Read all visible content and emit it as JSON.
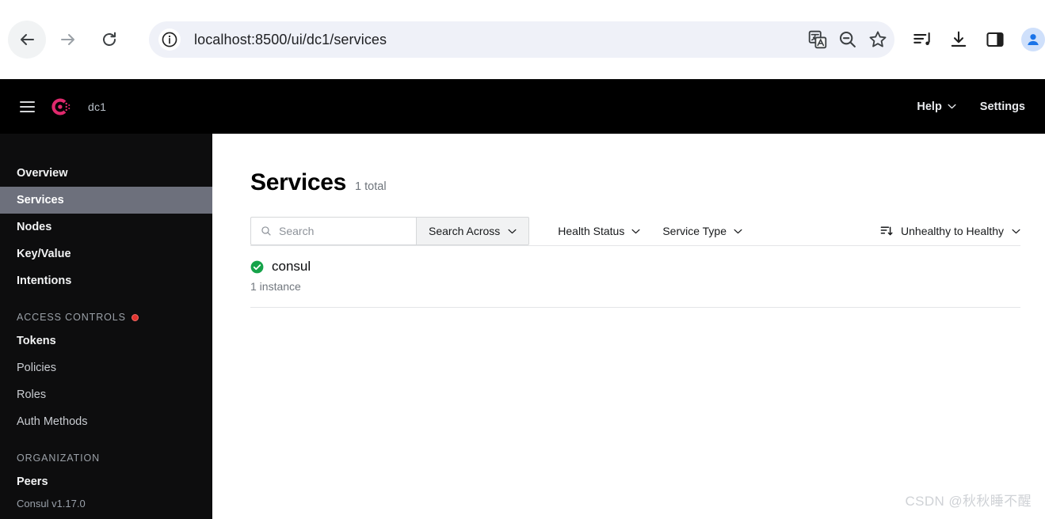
{
  "browser": {
    "url": "localhost:8500/ui/dc1/services",
    "back_icon": "back-arrow-icon",
    "forward_icon": "forward-arrow-icon",
    "reload_icon": "reload-icon",
    "info_icon": "site-info-icon",
    "omnibox_actions": [
      "translate-icon",
      "zoom-out-icon",
      "bookmark-star-icon"
    ],
    "toolbar_actions": [
      "media-playlist-icon",
      "download-icon",
      "side-panel-icon",
      "profile-avatar"
    ]
  },
  "app_header": {
    "menu_icon": "hamburger-menu-icon",
    "logo_icon": "consul-logo-icon",
    "datacenter": "dc1",
    "help_label": "Help",
    "settings_label": "Settings"
  },
  "sidebar": {
    "items": [
      {
        "label": "Overview",
        "active": false,
        "strong": true
      },
      {
        "label": "Services",
        "active": true,
        "strong": true
      },
      {
        "label": "Nodes",
        "active": false,
        "strong": true
      },
      {
        "label": "Key/Value",
        "active": false,
        "strong": true
      },
      {
        "label": "Intentions",
        "active": false,
        "strong": true
      }
    ],
    "access_controls_label": "ACCESS CONTROLS",
    "access_controls_badge": "red-dot-indicator",
    "acl_items": [
      {
        "label": "Tokens",
        "strong": true
      },
      {
        "label": "Policies",
        "strong": false
      },
      {
        "label": "Roles",
        "strong": false
      },
      {
        "label": "Auth Methods",
        "strong": false
      }
    ],
    "organization_label": "ORGANIZATION",
    "org_items": [
      {
        "label": "Peers",
        "strong": true
      }
    ],
    "version": "Consul v1.17.0"
  },
  "main": {
    "title": "Services",
    "total": "1 total",
    "search": {
      "placeholder": "Search",
      "icon": "search-icon",
      "across_label": "Search Across"
    },
    "filters": [
      {
        "label": "Health Status"
      },
      {
        "label": "Service Type"
      }
    ],
    "sort": {
      "icon": "sort-descending-icon",
      "label": "Unhealthy to Healthy"
    },
    "services": [
      {
        "name": "consul",
        "instances": "1 instance",
        "health": "passing",
        "health_icon": "check-circle-icon"
      }
    ]
  },
  "watermark": "CSDN @秋秋睡不醒",
  "colors": {
    "brand_pink": "#e0296d",
    "health_green": "#16a34a",
    "sidebar_bg": "#0d0d0e",
    "active_nav": "#6d707c",
    "header_bg": "#000000",
    "omnibox_bg": "#eff1f8",
    "acl_badge_red": "#e3342f"
  }
}
